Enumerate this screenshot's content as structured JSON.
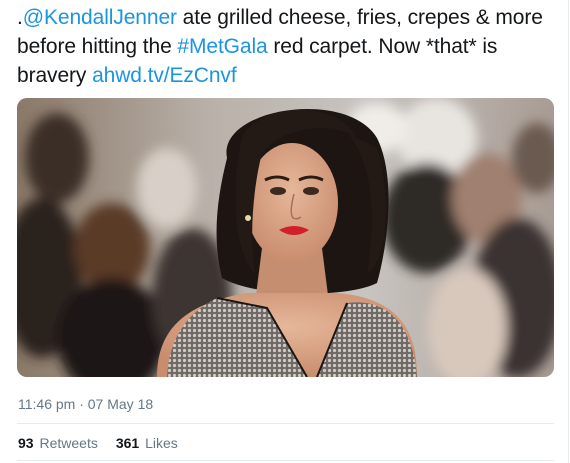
{
  "tweet": {
    "text_segments": [
      {
        "text": ".",
        "type": "plain"
      },
      {
        "text": "@KendallJenner",
        "type": "link"
      },
      {
        "text": " ate grilled cheese, fries, crepes & more before hitting the ",
        "type": "plain"
      },
      {
        "text": "#MetGala",
        "type": "link"
      },
      {
        "text": " red carpet. Now *that* is bravery ",
        "type": "plain"
      },
      {
        "text": "ahwd.tv/EzCnvf",
        "type": "link"
      }
    ],
    "timestamp": "11:46 pm · 07 May 18",
    "retweets_count": "93",
    "retweets_label": "Retweets",
    "likes_count": "361",
    "likes_label": "Likes"
  },
  "colors": {
    "link": "#1b95e0",
    "text": "#14171a",
    "secondary": "#657786",
    "divider": "#e6ecf0"
  }
}
